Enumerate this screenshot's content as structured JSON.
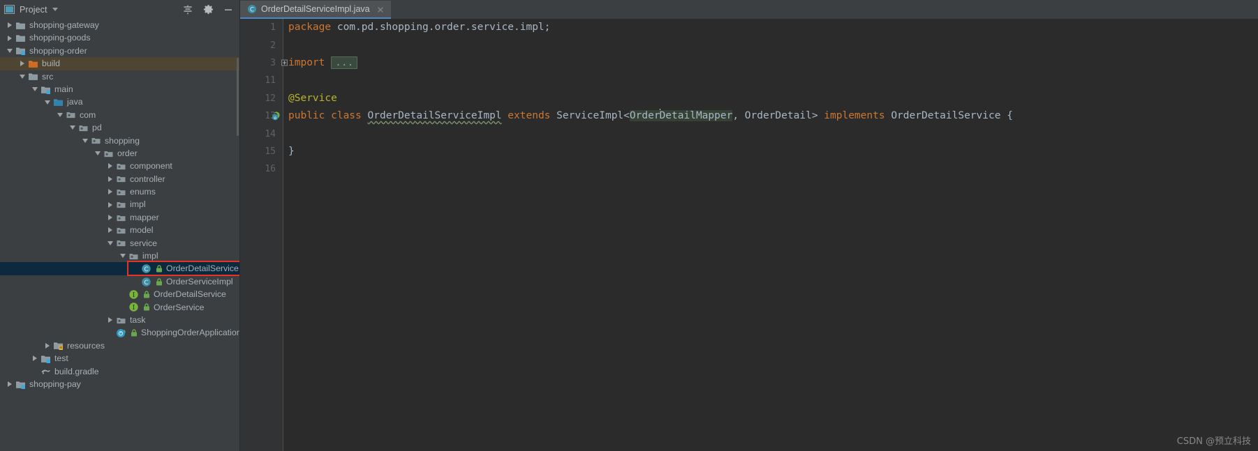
{
  "toolwindow": {
    "title": "Project",
    "icon": "project-view-icon",
    "caret_icon": "chevron-down-icon",
    "actions": [
      {
        "name": "collapse-all-button",
        "icon": "collapse-all-icon",
        "tooltip": "Collapse All"
      },
      {
        "name": "settings-button",
        "icon": "gear-icon",
        "tooltip": "Settings"
      },
      {
        "name": "hide-button",
        "icon": "minimize-icon",
        "tooltip": "Hide"
      }
    ]
  },
  "editor_tabs": [
    {
      "label": "OrderDetailServiceImpl.java",
      "icon": "java-class-icon",
      "active": true,
      "close_icon": "close-icon"
    }
  ],
  "tree": {
    "items": [
      {
        "label": "shopping-gateway",
        "indent": 0,
        "twist": "right",
        "icon": "module-folder-icon",
        "state": "normal"
      },
      {
        "label": "shopping-goods",
        "indent": 0,
        "twist": "right",
        "icon": "module-folder-icon",
        "state": "normal"
      },
      {
        "label": "shopping-order",
        "indent": 0,
        "twist": "down",
        "icon": "module-badge-icon",
        "state": "normal"
      },
      {
        "label": "build",
        "indent": 1,
        "twist": "right",
        "icon": "excluded-folder-icon",
        "state": "hover"
      },
      {
        "label": "src",
        "indent": 1,
        "twist": "down",
        "icon": "folder-icon",
        "state": "normal"
      },
      {
        "label": "main",
        "indent": 2,
        "twist": "down",
        "icon": "module-badge-icon",
        "state": "normal"
      },
      {
        "label": "java",
        "indent": 3,
        "twist": "down",
        "icon": "source-root-icon",
        "state": "normal"
      },
      {
        "label": "com",
        "indent": 4,
        "twist": "down",
        "icon": "package-icon",
        "state": "normal"
      },
      {
        "label": "pd",
        "indent": 5,
        "twist": "down",
        "icon": "package-icon",
        "state": "normal"
      },
      {
        "label": "shopping",
        "indent": 6,
        "twist": "down",
        "icon": "package-icon",
        "state": "normal"
      },
      {
        "label": "order",
        "indent": 7,
        "twist": "down",
        "icon": "package-icon",
        "state": "normal"
      },
      {
        "label": "component",
        "indent": 8,
        "twist": "right",
        "icon": "package-icon",
        "state": "normal"
      },
      {
        "label": "controller",
        "indent": 8,
        "twist": "right",
        "icon": "package-icon",
        "state": "normal"
      },
      {
        "label": "enums",
        "indent": 8,
        "twist": "right",
        "icon": "package-icon",
        "state": "normal"
      },
      {
        "label": "impl",
        "indent": 8,
        "twist": "right",
        "icon": "package-icon",
        "state": "normal"
      },
      {
        "label": "mapper",
        "indent": 8,
        "twist": "right",
        "icon": "package-icon",
        "state": "normal"
      },
      {
        "label": "model",
        "indent": 8,
        "twist": "right",
        "icon": "package-icon",
        "state": "normal"
      },
      {
        "label": "service",
        "indent": 8,
        "twist": "down",
        "icon": "package-icon",
        "state": "normal"
      },
      {
        "label": "impl",
        "indent": 9,
        "twist": "down",
        "icon": "package-icon",
        "state": "normal"
      },
      {
        "label": "OrderDetailServiceImpl",
        "indent": 10,
        "twist": "none",
        "icon": "java-class-icon",
        "state": "selected",
        "overlay": "public-badge-icon"
      },
      {
        "label": "OrderServiceImpl",
        "indent": 10,
        "twist": "none",
        "icon": "java-class-icon",
        "state": "normal",
        "overlay": "public-badge-icon"
      },
      {
        "label": "OrderDetailService",
        "indent": 9,
        "twist": "none",
        "icon": "java-interface-icon",
        "state": "normal",
        "overlay": "public-badge-icon"
      },
      {
        "label": "OrderService",
        "indent": 9,
        "twist": "none",
        "icon": "java-interface-icon",
        "state": "normal",
        "overlay": "public-badge-icon"
      },
      {
        "label": "task",
        "indent": 8,
        "twist": "right",
        "icon": "package-icon",
        "state": "normal"
      },
      {
        "label": "ShoppingOrderApplication",
        "indent": 8,
        "twist": "none",
        "icon": "spring-boot-icon",
        "state": "normal",
        "overlay": "public-badge-icon"
      },
      {
        "label": "resources",
        "indent": 3,
        "twist": "right",
        "icon": "resource-root-icon",
        "state": "normal"
      },
      {
        "label": "test",
        "indent": 2,
        "twist": "right",
        "icon": "test-root-icon",
        "state": "normal"
      },
      {
        "label": "build.gradle",
        "indent": 2,
        "twist": "none",
        "icon": "gradle-file-icon",
        "state": "normal"
      },
      {
        "label": "shopping-pay",
        "indent": 0,
        "twist": "right",
        "icon": "module-badge-icon",
        "state": "normal"
      }
    ],
    "annotation": {
      "name": "red-highlight-box",
      "target": "OrderDetailServiceImpl",
      "color": "#e83223"
    }
  },
  "code": {
    "line_numbers": [
      "1",
      "2",
      "3",
      "11",
      "12",
      "13",
      "14",
      "15",
      "16"
    ],
    "lines": [
      {
        "n": "1",
        "tokens": [
          {
            "t": "package ",
            "c": "kw"
          },
          {
            "t": "com.pd.shopping.order.service.impl;",
            "c": "plain"
          }
        ]
      },
      {
        "n": "2",
        "tokens": []
      },
      {
        "n": "3",
        "tokens": [
          {
            "t": "import ",
            "c": "kw"
          },
          {
            "t": "...",
            "c": "fold"
          }
        ],
        "fold": true
      },
      {
        "n": "11",
        "tokens": []
      },
      {
        "n": "12",
        "tokens": [
          {
            "t": "@Service",
            "c": "ann"
          }
        ]
      },
      {
        "n": "13",
        "tokens": [
          {
            "t": "public ",
            "c": "kw"
          },
          {
            "t": "class ",
            "c": "kw"
          },
          {
            "t": "OrderDetailServiceImpl",
            "c": "wavy"
          },
          {
            "t": " ",
            "c": "plain"
          },
          {
            "t": "extends",
            "c": "kw"
          },
          {
            "t": " ServiceImpl<",
            "c": "plain"
          },
          {
            "t": "Order",
            "c": "hl"
          },
          {
            "t": "|caret|",
            "c": "caret"
          },
          {
            "t": "DetailMapper",
            "c": "hl"
          },
          {
            "t": ", OrderDetail> ",
            "c": "plain"
          },
          {
            "t": "implements",
            "c": "kw"
          },
          {
            "t": " OrderDetailService {",
            "c": "plain"
          }
        ],
        "gutter_icon": "spring-bean-gutter-icon"
      },
      {
        "n": "14",
        "tokens": []
      },
      {
        "n": "15",
        "tokens": [
          {
            "t": "}",
            "c": "plain"
          }
        ]
      },
      {
        "n": "16",
        "tokens": []
      }
    ]
  },
  "watermark": {
    "text": "CSDN @预立科技"
  },
  "colors": {
    "tree_bg": "#3c3f41",
    "editor_bg": "#2b2b2b",
    "gutter_bg": "#313335",
    "selection_blue": "#0d293e",
    "hover_olive": "#4e4632",
    "keyword_orange": "#cc7832",
    "annotation_yellow": "#bbb529",
    "text_gray": "#a9b7c6",
    "tab_underline": "#4a88c7",
    "annotation_red": "#e83223"
  }
}
